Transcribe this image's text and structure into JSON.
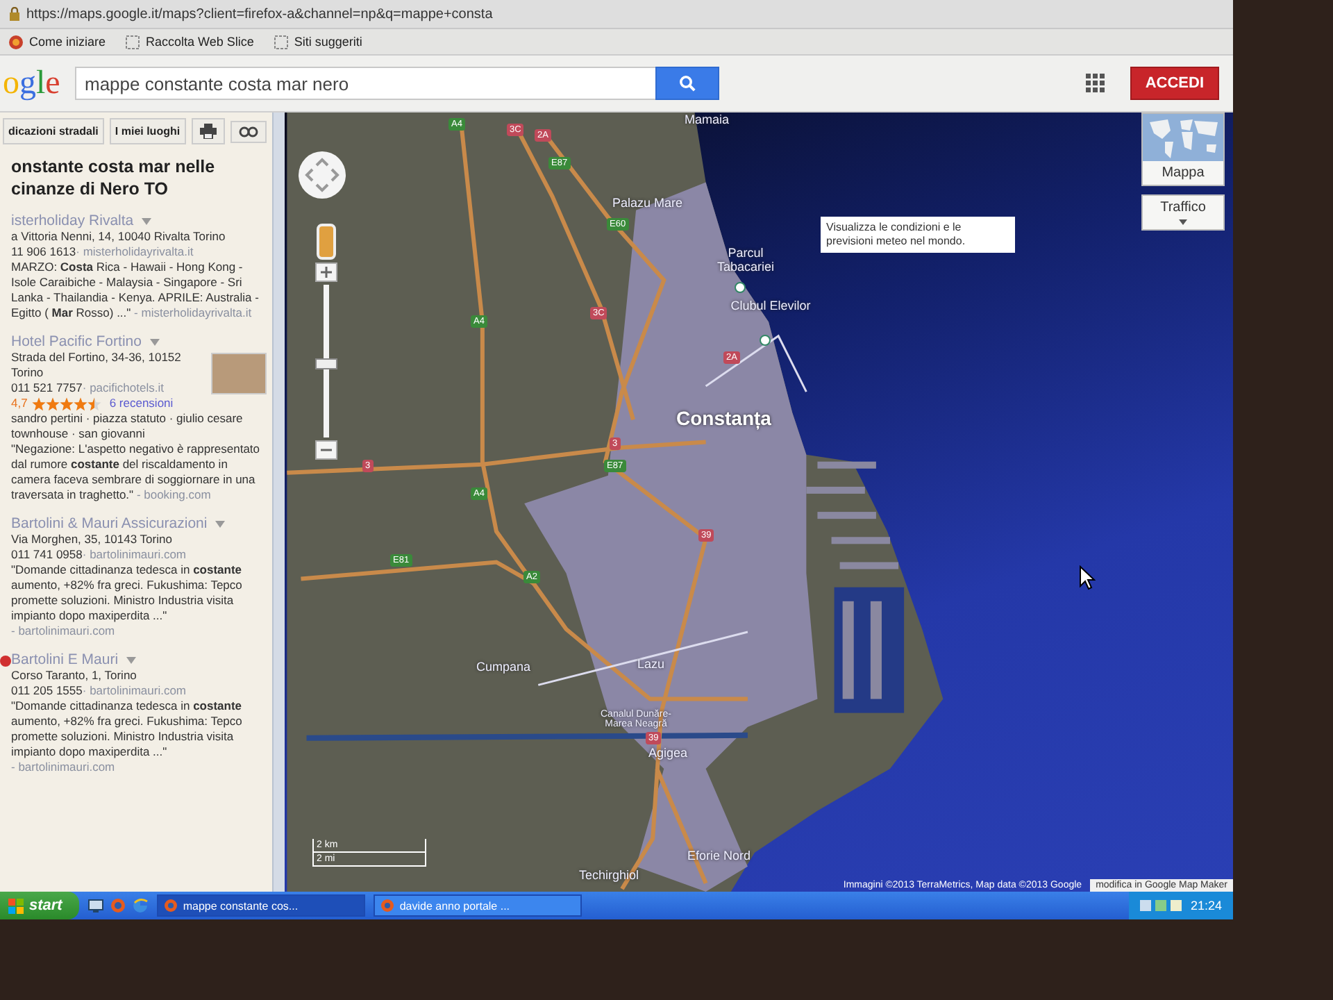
{
  "browser": {
    "url": "https://maps.google.it/maps?client=firefox-a&channel=np&q=mappe+consta",
    "bookmarks": [
      {
        "label": "Come iniziare",
        "kind": "site"
      },
      {
        "label": "Raccolta Web Slice",
        "kind": "slice"
      },
      {
        "label": "Siti suggeriti",
        "kind": "slice"
      }
    ]
  },
  "header": {
    "logo": "ogle",
    "search": {
      "value": "mappe constante costa mar nero"
    },
    "signin": "ACCEDI"
  },
  "panel": {
    "toolbar": [
      "dicazioni stradali",
      "I miei luoghi"
    ],
    "heading": "onstante costa mar nelle cinanze di Nero TO",
    "results": [
      {
        "title": "isterholiday Rivalta",
        "address": "a Vittoria Nenni, 14, 10040 Rivalta Torino",
        "phone": "11 906 1613",
        "site": "· misterholidayrivalta.it",
        "snippet": "MARZO: **Costa** Rica - Hawaii - Hong Kong - Isole Caraibiche - Malaysia - Singapore - Sri Lanka - Thailandia - Kenya. APRILE: Australia - Egitto ( **Mar** Rosso) ...\"",
        "source": "- misterholidayrivalta.it",
        "photo": false,
        "marker": false
      },
      {
        "title": "Hotel Pacific Fortino",
        "address": "Strada del Fortino, 34-36, 10152 Torino",
        "phone": "011 521 7757",
        "site": "· pacifichotels.it",
        "rating": "4,7",
        "stars": 4.5,
        "reviews": "6 recensioni",
        "tags": "sandro pertini · piazza statuto · giulio cesare townhouse · san giovanni",
        "snippet": "\"Negazione: L'aspetto negativo è rappresentato dal rumore **costante** del riscaldamento in camera faceva sembrare di soggiornare in una traversata in traghetto.\"",
        "source": "- booking.com",
        "photo": true,
        "marker": false
      },
      {
        "title": "Bartolini & Mauri Assicurazioni",
        "address": "Via Morghen, 35, 10143 Torino",
        "phone": "011 741 0958",
        "site": "· bartolinimauri.com",
        "snippet": "\"Domande cittadinanza tedesca in **costante** aumento, +82% fra greci. Fukushima: Tepco promette soluzioni. Ministro Industria visita impianto dopo maxiperdita ...\"",
        "source": "- bartolinimauri.com",
        "photo": false,
        "marker": false
      },
      {
        "title": "Bartolini E Mauri",
        "address": "Corso Taranto, 1, Torino",
        "phone": "011 205 1555",
        "site": "· bartolinimauri.com",
        "snippet": "\"Domande cittadinanza tedesca in **costante** aumento, +82% fra greci. Fukushima: Tepco promette soluzioni. Ministro Industria visita impianto dopo maxiperdita ...\"",
        "source": "- bartolinimauri.com",
        "photo": false,
        "marker": true
      }
    ]
  },
  "map": {
    "zoom": {
      "level": 0.45
    },
    "layers": [
      {
        "label": "Mappa",
        "kind": "map"
      },
      {
        "label": "Traffico",
        "kind": "traffic"
      }
    ],
    "tooltip": "Visualizza le condizioni e le previsioni meteo nel mondo.",
    "places": [
      {
        "label": "Mamaia",
        "kind": "town"
      },
      {
        "label": "Palazu Mare",
        "kind": "town"
      },
      {
        "label": "Parcul Tabacariei",
        "kind": "poi"
      },
      {
        "label": "Clubul Elevilor",
        "kind": "poi"
      },
      {
        "label": "Constanța",
        "kind": "city"
      },
      {
        "label": "Cumpana",
        "kind": "town"
      },
      {
        "label": "Lazu",
        "kind": "town"
      },
      {
        "label": "Canalul Dunăre-Marea Neagră",
        "kind": "water"
      },
      {
        "label": "Agigea",
        "kind": "town"
      },
      {
        "label": "Eforie Nord",
        "kind": "town"
      },
      {
        "label": "Techirghiol",
        "kind": "town"
      }
    ],
    "shields": [
      {
        "label": "A4",
        "kind": "motorway"
      },
      {
        "label": "3C",
        "kind": "national"
      },
      {
        "label": "2A",
        "kind": "national"
      },
      {
        "label": "E87",
        "kind": "motorway"
      },
      {
        "label": "E60",
        "kind": "motorway"
      },
      {
        "label": "A4",
        "kind": "motorway"
      },
      {
        "label": "3C",
        "kind": "national"
      },
      {
        "label": "2A",
        "kind": "national"
      },
      {
        "label": "E87",
        "kind": "motorway"
      },
      {
        "label": "3",
        "kind": "national"
      },
      {
        "label": "3",
        "kind": "national"
      },
      {
        "label": "A4",
        "kind": "motorway"
      },
      {
        "label": "E81",
        "kind": "motorway"
      },
      {
        "label": "A2",
        "kind": "motorway"
      },
      {
        "label": "39",
        "kind": "national"
      },
      {
        "label": "39",
        "kind": "national"
      }
    ],
    "scale": [
      "2 km",
      "2 mi"
    ],
    "attribution": "Immagini ©2013 TerraMetrics, Map data ©2013 Google",
    "edit_link": "modifica in Google Map Maker"
  },
  "taskbar": {
    "start": "start",
    "tasks": [
      {
        "label": "mappe constante cos...",
        "selected": true
      },
      {
        "label": "davide anno portale ...",
        "selected": false
      }
    ],
    "clock": "21:24"
  }
}
